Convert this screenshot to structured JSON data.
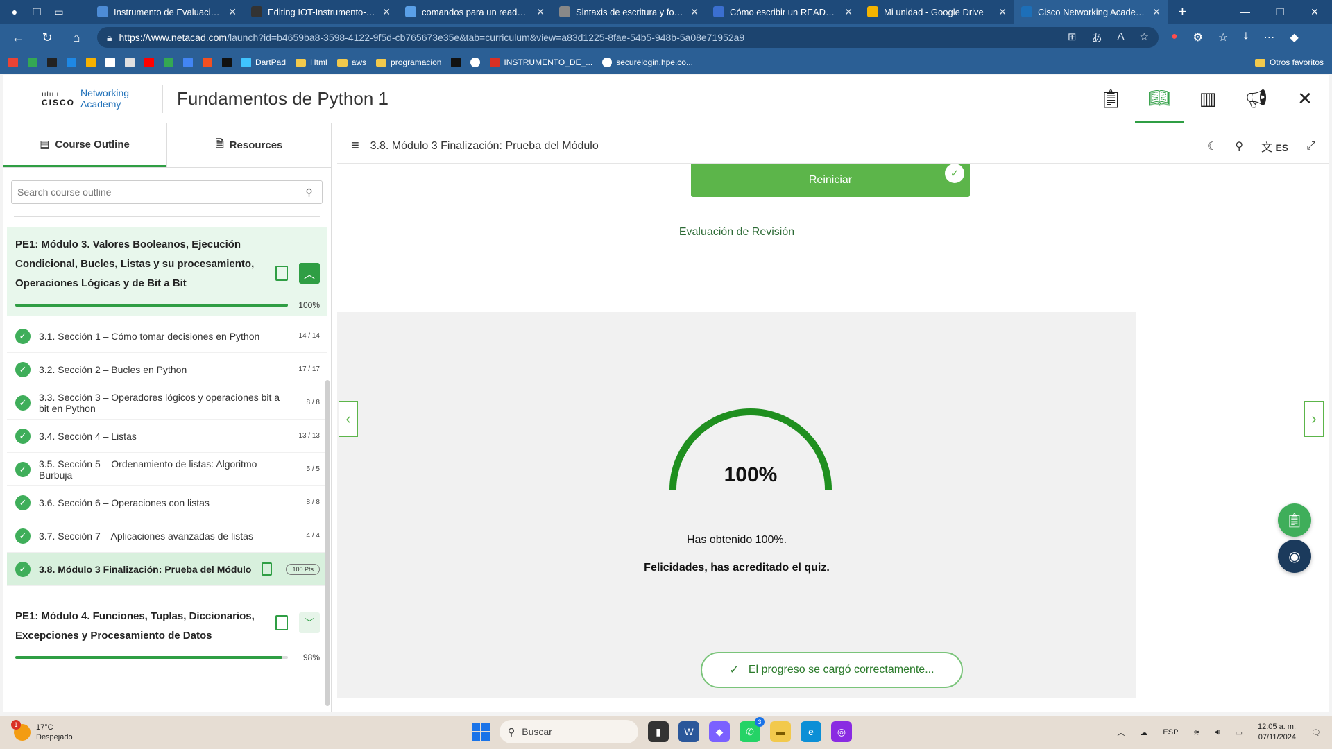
{
  "browser": {
    "tabs": [
      {
        "title": "Instrumento de Evaluación Uni",
        "active": false
      },
      {
        "title": "Editing IOT-Instrumento-de-Ev",
        "active": false
      },
      {
        "title": "comandos para un readme en",
        "active": false
      },
      {
        "title": "Sintaxis de escritura y formato",
        "active": false
      },
      {
        "title": "Cómo escribir un README inc",
        "active": false
      },
      {
        "title": "Mi unidad - Google Drive",
        "active": false
      },
      {
        "title": "Cisco Networking Academy",
        "active": true
      }
    ],
    "url_host": "https://www.netacad.com",
    "url_path": "/launch?id=b4659ba8-3598-4122-9f5d-cb765673e35e&tab=curriculum&view=a83d1225-8fae-54b5-948b-5a08e71952a9",
    "bookmarks": [
      "DartPad",
      "Html",
      "aws",
      "programacion",
      "INSTRUMENTO_DE_...",
      "securelogin.hpe.co..."
    ],
    "bookmarks_other": "Otros favoritos"
  },
  "app": {
    "logo_brand": "CISCO",
    "logo_line1": "Networking",
    "logo_line2": "Academy",
    "course_title": "Fundamentos de Python 1"
  },
  "sidebar": {
    "tab_outline": "Course Outline",
    "tab_resources": "Resources",
    "search_placeholder": "Search course outline",
    "module3": {
      "title": "PE1: Módulo 3. Valores Booleanos, Ejecución Condicional, Bucles, Listas y su procesamiento, Operaciones Lógicas y de Bit a Bit",
      "progress_label": "100%",
      "progress": 1.0
    },
    "sections": [
      {
        "label": "3.1. Sección 1 – Cómo tomar decisiones en Python",
        "count": "14 / 14"
      },
      {
        "label": "3.2. Sección 2 – Bucles en Python",
        "count": "17 / 17"
      },
      {
        "label": "3.3. Sección 3 – Operadores lógicos y operaciones bit a bit en Python",
        "count": "8 / 8"
      },
      {
        "label": "3.4. Sección 4 – Listas",
        "count": "13 / 13"
      },
      {
        "label": "3.5. Sección 5 – Ordenamiento de listas: Algoritmo Burbuja",
        "count": "5 / 5"
      },
      {
        "label": "3.6. Sección 6 – Operaciones con listas",
        "count": "8 / 8"
      },
      {
        "label": "3.7. Sección 7 – Aplicaciones avanzadas de listas",
        "count": "4 / 4"
      }
    ],
    "active_section": {
      "label": "3.8. Módulo 3 Finalización: Prueba del Módulo",
      "points": "100 Pts"
    },
    "module4": {
      "title": "PE1: Módulo 4. Funciones, Tuplas, Diccionarios, Excepciones y Procesamiento de Datos",
      "progress_label": "98%",
      "progress": 0.98
    }
  },
  "main": {
    "heading": "3.8. Módulo 3 Finalización: Prueba del Módulo",
    "lang": "ES",
    "restart_label": "Reiniciar",
    "review_link": "Evaluación de Revisión",
    "score_pct_label": "100%",
    "score": 1.0,
    "score_text": "Has obtenido 100%.",
    "congrats_text": "Felicidades, has acreditado el quiz.",
    "toast_text": "El progreso se cargó correctamente..."
  },
  "taskbar": {
    "weather_temp": "17°C",
    "weather_desc": "Despejado",
    "weather_badge": "1",
    "search_label": "Buscar",
    "whatsapp_badge": "3",
    "lang": "ESP",
    "time": "12:05 a. m.",
    "date": "07/11/2024"
  },
  "colors": {
    "accent": "#2f9e44",
    "browser_chrome": "#2b5f95",
    "module_bg": "#e8f7ec"
  }
}
